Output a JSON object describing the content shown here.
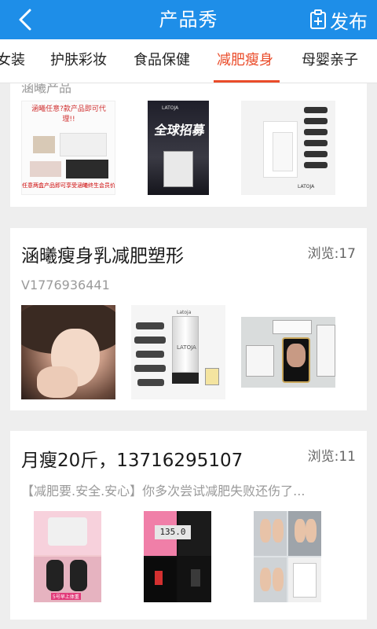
{
  "header": {
    "title": "产品秀",
    "publish_label": "发布",
    "back_icon": "chevron-left-icon",
    "publish_icon": "clipboard-plus-icon"
  },
  "tabs": [
    {
      "label": "女装",
      "active": false
    },
    {
      "label": "护肤彩妆",
      "active": false
    },
    {
      "label": "食品保健",
      "active": false
    },
    {
      "label": "减肥瘦身",
      "active": true
    },
    {
      "label": "母婴亲子",
      "active": false
    }
  ],
  "colors": {
    "header_bg": "#1e8ee8",
    "active_tab": "#ea4c2a",
    "page_bg": "#eeeeee"
  },
  "posts": [
    {
      "partial_text": "涵曦产品",
      "image_texts": [
        "涵曦任意?款产品即可代理!!",
        "任意两盒产品即可享受涵曦终生会员价",
        "全球招募",
        "LATOJA",
        "LATOJA"
      ]
    },
    {
      "title": "涵曦瘦身乳减肥塑形",
      "views": "浏览:17",
      "subtitle": "V1776936441",
      "image_texts": [
        "LATOJA",
        "Latoja"
      ]
    },
    {
      "title": "月瘦20斤，13716295107",
      "views": "浏览:11",
      "subtitle": "【减肥要.安全.安心】你多次尝试减肥失败还伤了...",
      "image_texts": [
        "5号早上体重",
        "135.0"
      ]
    }
  ]
}
